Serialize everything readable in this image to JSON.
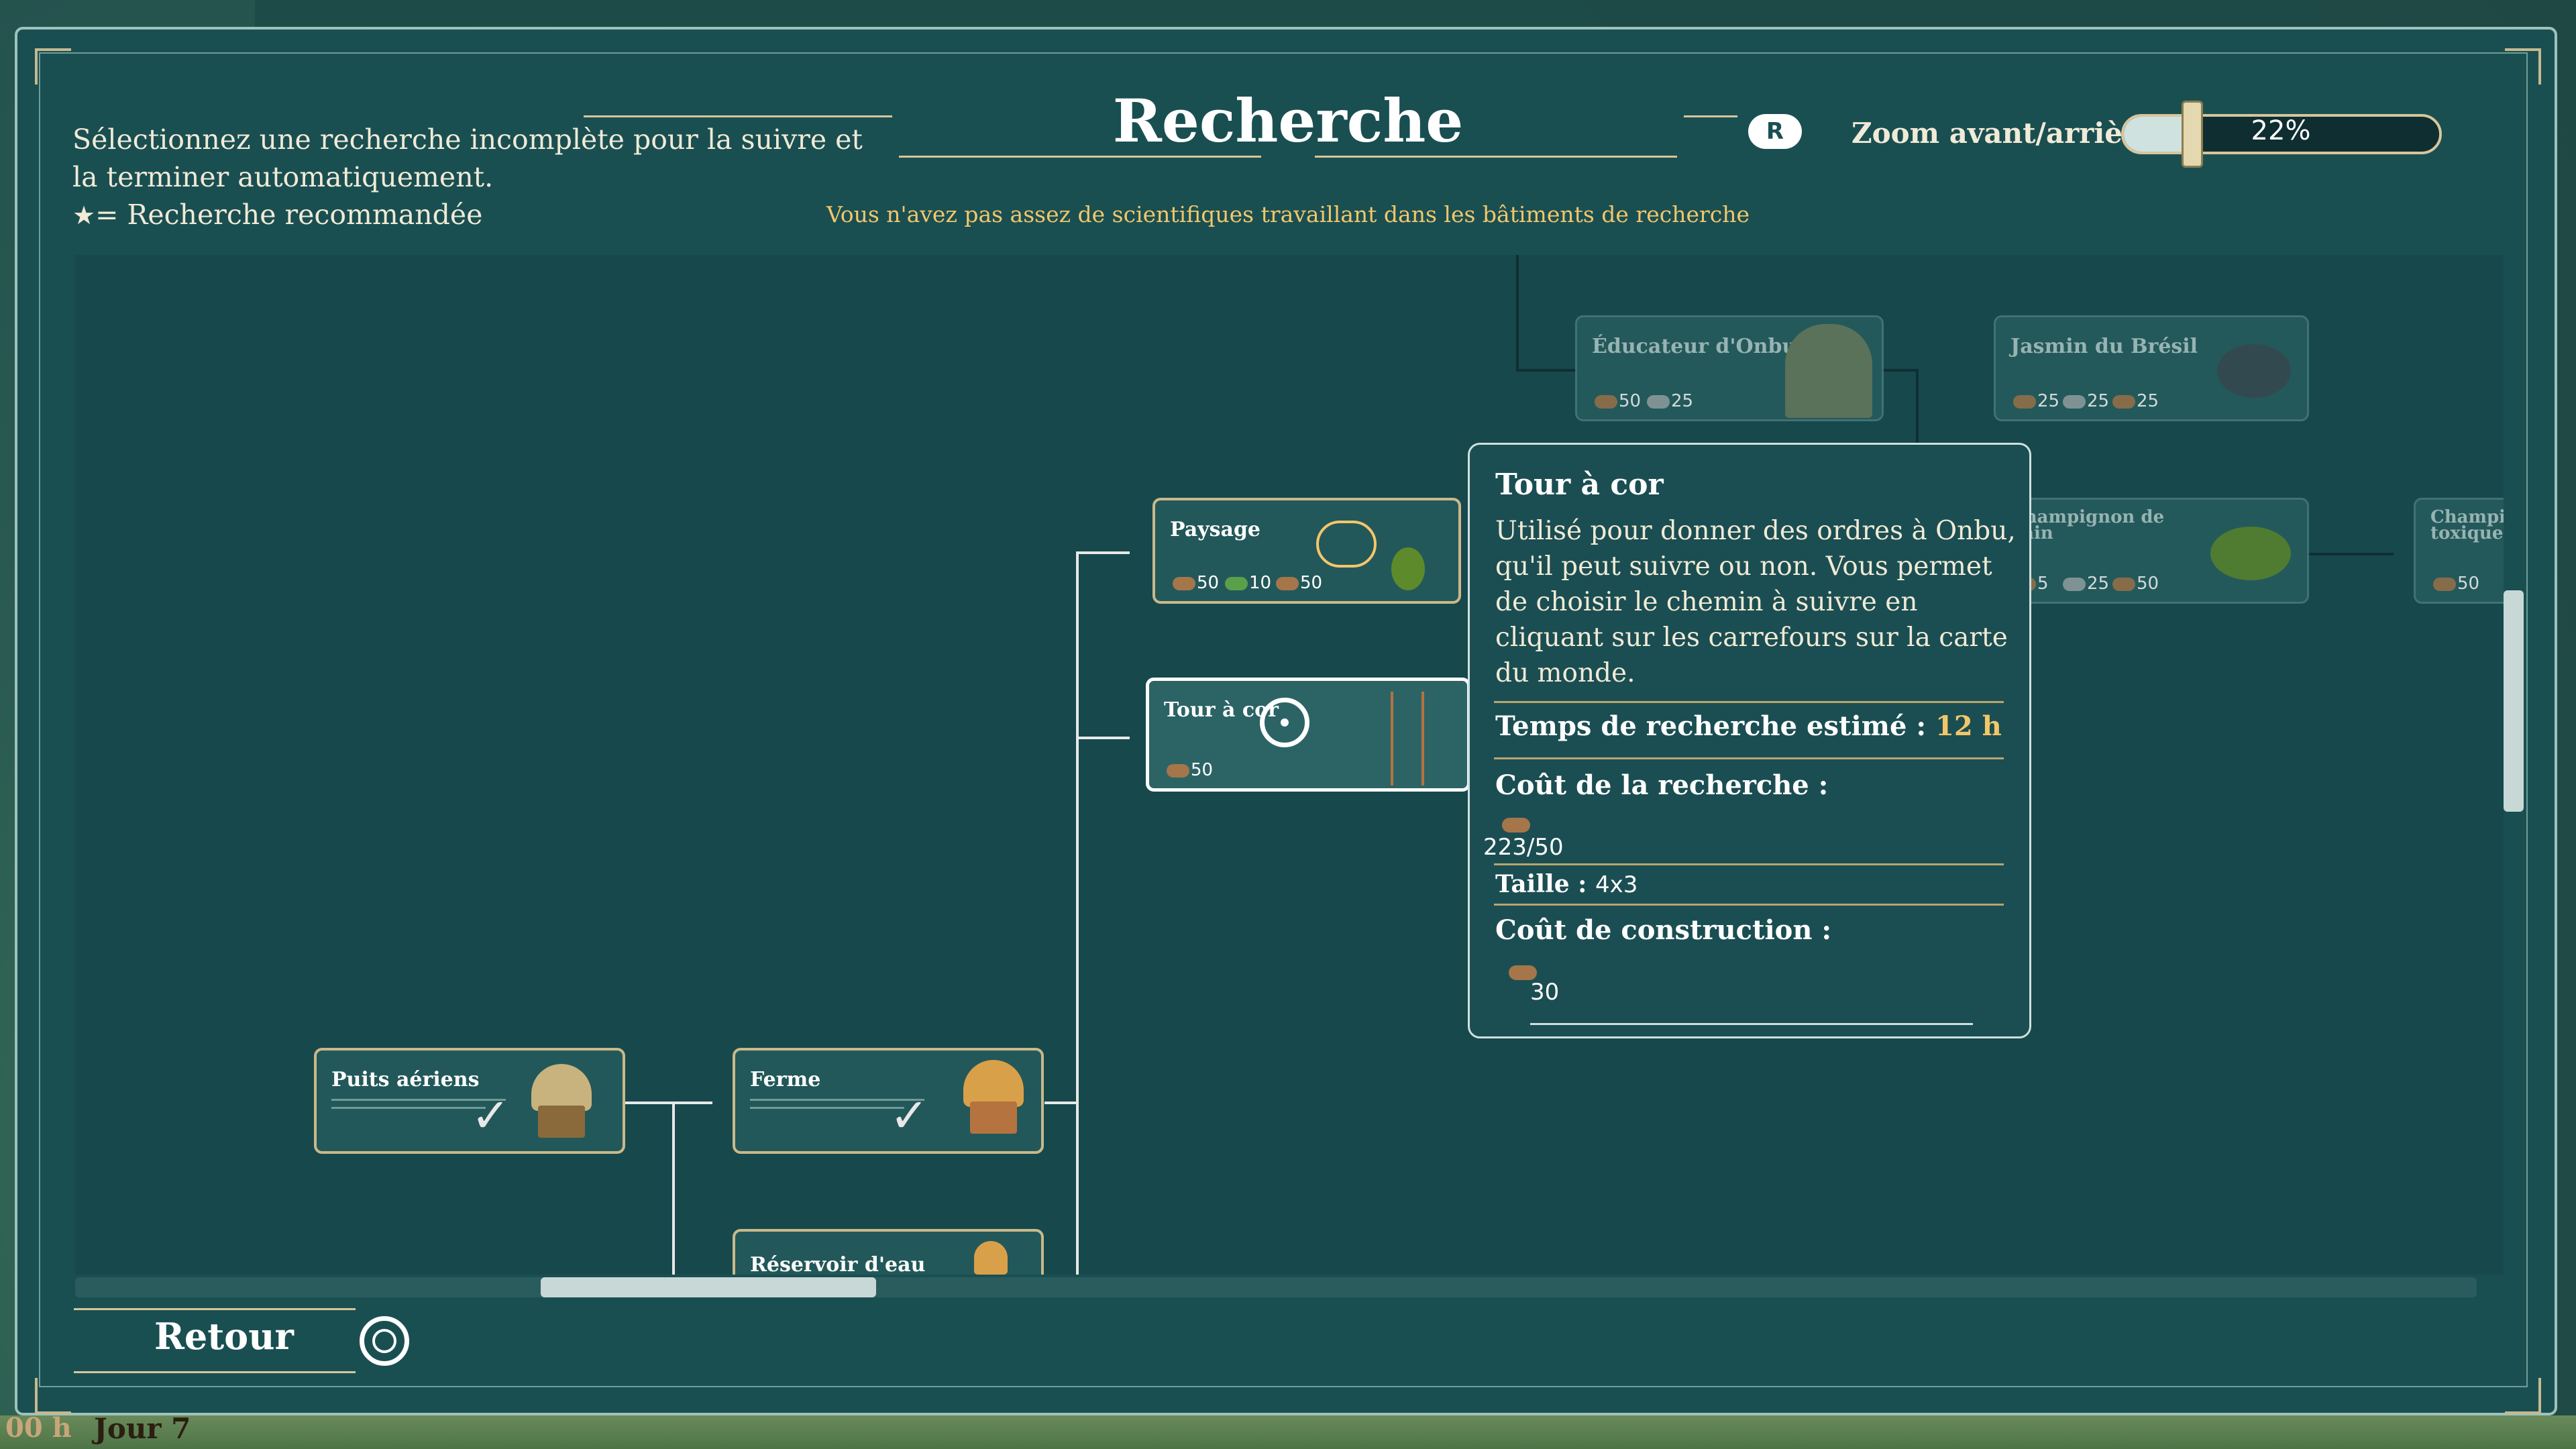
{
  "screen": {
    "title": "Recherche",
    "instructions": "Sélectionnez une recherche incomplète pour la suivre et la terminer automatiquement.",
    "star_legend": "= Recherche recommandée",
    "warning": "Vous n'avez pas assez de scientifiques travaillant dans les bâtiments de recherche"
  },
  "zoom": {
    "key": "R",
    "label": "Zoom avant/arrière",
    "value": "22%",
    "level_fraction": 0.22
  },
  "nodes": {
    "puits": {
      "title": "Puits aériens",
      "completed": true
    },
    "ferme": {
      "title": "Ferme",
      "completed": true
    },
    "reservoir": {
      "title": "Réservoir d'eau"
    },
    "paysage": {
      "title": "Paysage",
      "costs": [
        "50",
        "10",
        "50"
      ]
    },
    "tour": {
      "title": "Tour à cor",
      "costs": [
        "50"
      ]
    },
    "educateur": {
      "title": "Éducateur d'Onbu",
      "costs": [
        "50",
        "25"
      ]
    },
    "jasmin": {
      "title": "Jasmin du Brésil",
      "costs": [
        "25",
        "25",
        "25"
      ]
    },
    "champignon": {
      "title": "Champignon de pain",
      "costs": [
        "5",
        "25",
        "50"
      ]
    },
    "champi_toxique": {
      "title": "Champi toxique",
      "costs": [
        "50"
      ]
    }
  },
  "tooltip": {
    "title": "Tour à cor",
    "description": "Utilisé pour donner des ordres à Onbu, qu'il peut suivre ou non. Vous permet de choisir le chemin à suivre en cliquant sur les carrefours sur la carte du monde.",
    "time_label": "Temps de recherche estimé :",
    "time_value": "12 h",
    "research_cost_label": "Coût de la recherche :",
    "research_cost_value": "223/50",
    "size_label": "Taille :",
    "size_value": "4x3",
    "build_cost_label": "Coût de construction :",
    "build_cost_value": "30"
  },
  "footer": {
    "back_label": "Retour"
  },
  "status": {
    "time": "00 h",
    "day": "Jour 7"
  },
  "colors": {
    "panel": "#1a4f52",
    "accent_gold": "#c9b98a",
    "warning": "#f3c66a"
  }
}
